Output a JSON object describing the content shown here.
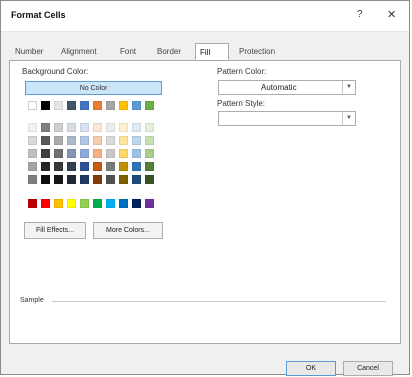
{
  "window": {
    "title": "Format Cells",
    "help_label": "?",
    "close_label": "✕"
  },
  "tabs": [
    {
      "label": "Number",
      "active": false
    },
    {
      "label": "Alignment",
      "active": false
    },
    {
      "label": "Font",
      "active": false
    },
    {
      "label": "Border",
      "active": false
    },
    {
      "label": "Fill",
      "active": true
    },
    {
      "label": "Protection",
      "active": false
    }
  ],
  "fill": {
    "background_color_label": "Background Color:",
    "no_color_label": "No Color",
    "fill_effects_label": "Fill Effects...",
    "more_colors_label": "More Colors..."
  },
  "pattern": {
    "color_label": "Pattern Color:",
    "color_value": "Automatic",
    "style_label": "Pattern Style:",
    "style_value": ""
  },
  "sample": {
    "label": "Sample"
  },
  "buttons": {
    "ok_label": "OK",
    "cancel_label": "Cancel"
  },
  "palette": {
    "theme_row": [
      "#ffffff",
      "#000000",
      "#e7e6e6",
      "#44546a",
      "#4472c4",
      "#ed7d31",
      "#a5a5a5",
      "#ffc000",
      "#5b9bd5",
      "#70ad47"
    ],
    "tint_rows": [
      [
        "#f2f2f2",
        "#7f7f7f",
        "#d0cece",
        "#d6dce4",
        "#d9e2f3",
        "#fbe5d5",
        "#ededed",
        "#fff2cc",
        "#deebf6",
        "#e2efd9"
      ],
      [
        "#d9d9d9",
        "#595959",
        "#aeabab",
        "#adb9ca",
        "#b4c6e7",
        "#f7cbac",
        "#dbdbdb",
        "#fee599",
        "#bdd7ee",
        "#c5e0b3"
      ],
      [
        "#bfbfbf",
        "#3f3f3f",
        "#757070",
        "#8496b0",
        "#8eaadb",
        "#f4b183",
        "#c9c9c9",
        "#ffd965",
        "#9cc3e5",
        "#a8d08d"
      ],
      [
        "#a6a6a6",
        "#262626",
        "#3a3838",
        "#323f4f",
        "#2f5496",
        "#c55a11",
        "#7b7b7b",
        "#bf9000",
        "#2e75b5",
        "#538135"
      ],
      [
        "#7f7f7f",
        "#0c0c0c",
        "#171616",
        "#222a35",
        "#1f3864",
        "#833c0b",
        "#525252",
        "#7f6000",
        "#1e4e79",
        "#375623"
      ]
    ],
    "standard_row": [
      "#c00000",
      "#ff0000",
      "#ffc000",
      "#ffff00",
      "#92d050",
      "#00b050",
      "#00b0f0",
      "#0070c0",
      "#002060",
      "#7030a0"
    ]
  }
}
